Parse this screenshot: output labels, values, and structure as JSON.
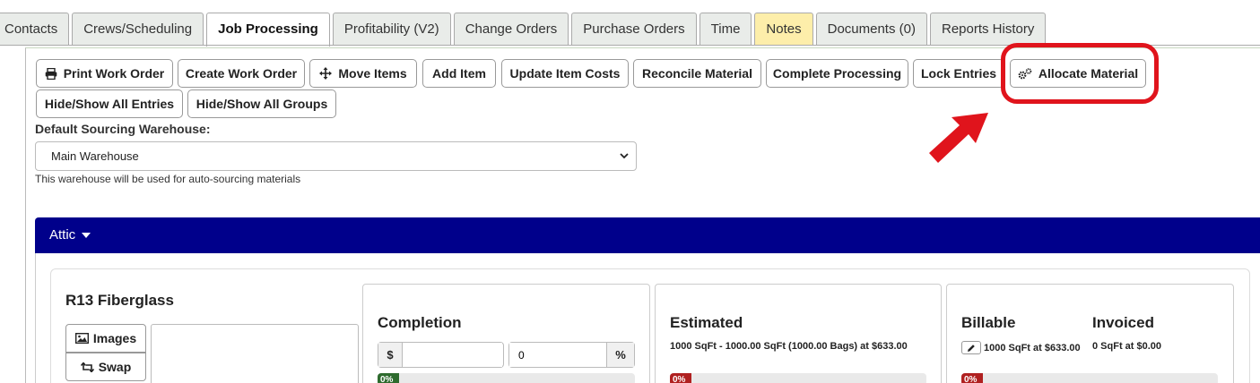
{
  "tabs": [
    {
      "label": "Contacts",
      "name": "tab-contacts",
      "active": false
    },
    {
      "label": "Crews/Scheduling",
      "name": "tab-crews-scheduling",
      "active": false
    },
    {
      "label": "Job Processing",
      "name": "tab-job-processing",
      "active": true
    },
    {
      "label": "Profitability (V2)",
      "name": "tab-profitability",
      "active": false
    },
    {
      "label": "Change Orders",
      "name": "tab-change-orders",
      "active": false
    },
    {
      "label": "Purchase Orders",
      "name": "tab-purchase-orders",
      "active": false
    },
    {
      "label": "Time",
      "name": "tab-time",
      "active": false
    },
    {
      "label": "Notes",
      "name": "tab-notes",
      "active": false
    },
    {
      "label": "Documents (0)",
      "name": "tab-documents",
      "active": false
    },
    {
      "label": "Reports History",
      "name": "tab-reports-history",
      "active": false
    }
  ],
  "toolbar": {
    "print_work_order": "Print Work Order",
    "create_work_order": "Create Work Order",
    "move_items": "Move Items",
    "add_item": "Add Item",
    "update_item_costs": "Update Item Costs",
    "reconcile_material": "Reconcile Material",
    "complete_processing": "Complete Processing",
    "lock_entries": "Lock Entries",
    "allocate_material": "Allocate Material",
    "hide_show_all_entries": "Hide/Show All Entries",
    "hide_show_all_groups": "Hide/Show All Groups"
  },
  "warehouse": {
    "label": "Default Sourcing Warehouse:",
    "selected": "Main Warehouse",
    "help": "This warehouse will be used for auto-sourcing materials"
  },
  "group": {
    "title": "Attic"
  },
  "item": {
    "title": "R13 Fiberglass",
    "images_label": "Images",
    "swap_label": "Swap",
    "completion": {
      "title": "Completion",
      "currency_symbol": "$",
      "dollar_value": "",
      "percent_value": "0",
      "percent_symbol": "%",
      "progress_label": "0%",
      "progress": 0
    },
    "estimated": {
      "title": "Estimated",
      "detail": "1000 SqFt - 1000.00 SqFt (1000.00 Bags) at $633.00",
      "progress_label": "0%",
      "progress": 0
    },
    "billable": {
      "title": "Billable",
      "detail": "1000 SqFt at $633.00",
      "progress_label": "0%",
      "progress": 0
    },
    "invoiced": {
      "title": "Invoiced",
      "detail": "0 SqFt at $0.00"
    }
  },
  "colors": {
    "header_blue": "#00008b",
    "notes_tab": "#fdeeaa",
    "highlight_red": "#e0141c",
    "progress_green": "#2e6b2e",
    "progress_red": "#b02020"
  }
}
